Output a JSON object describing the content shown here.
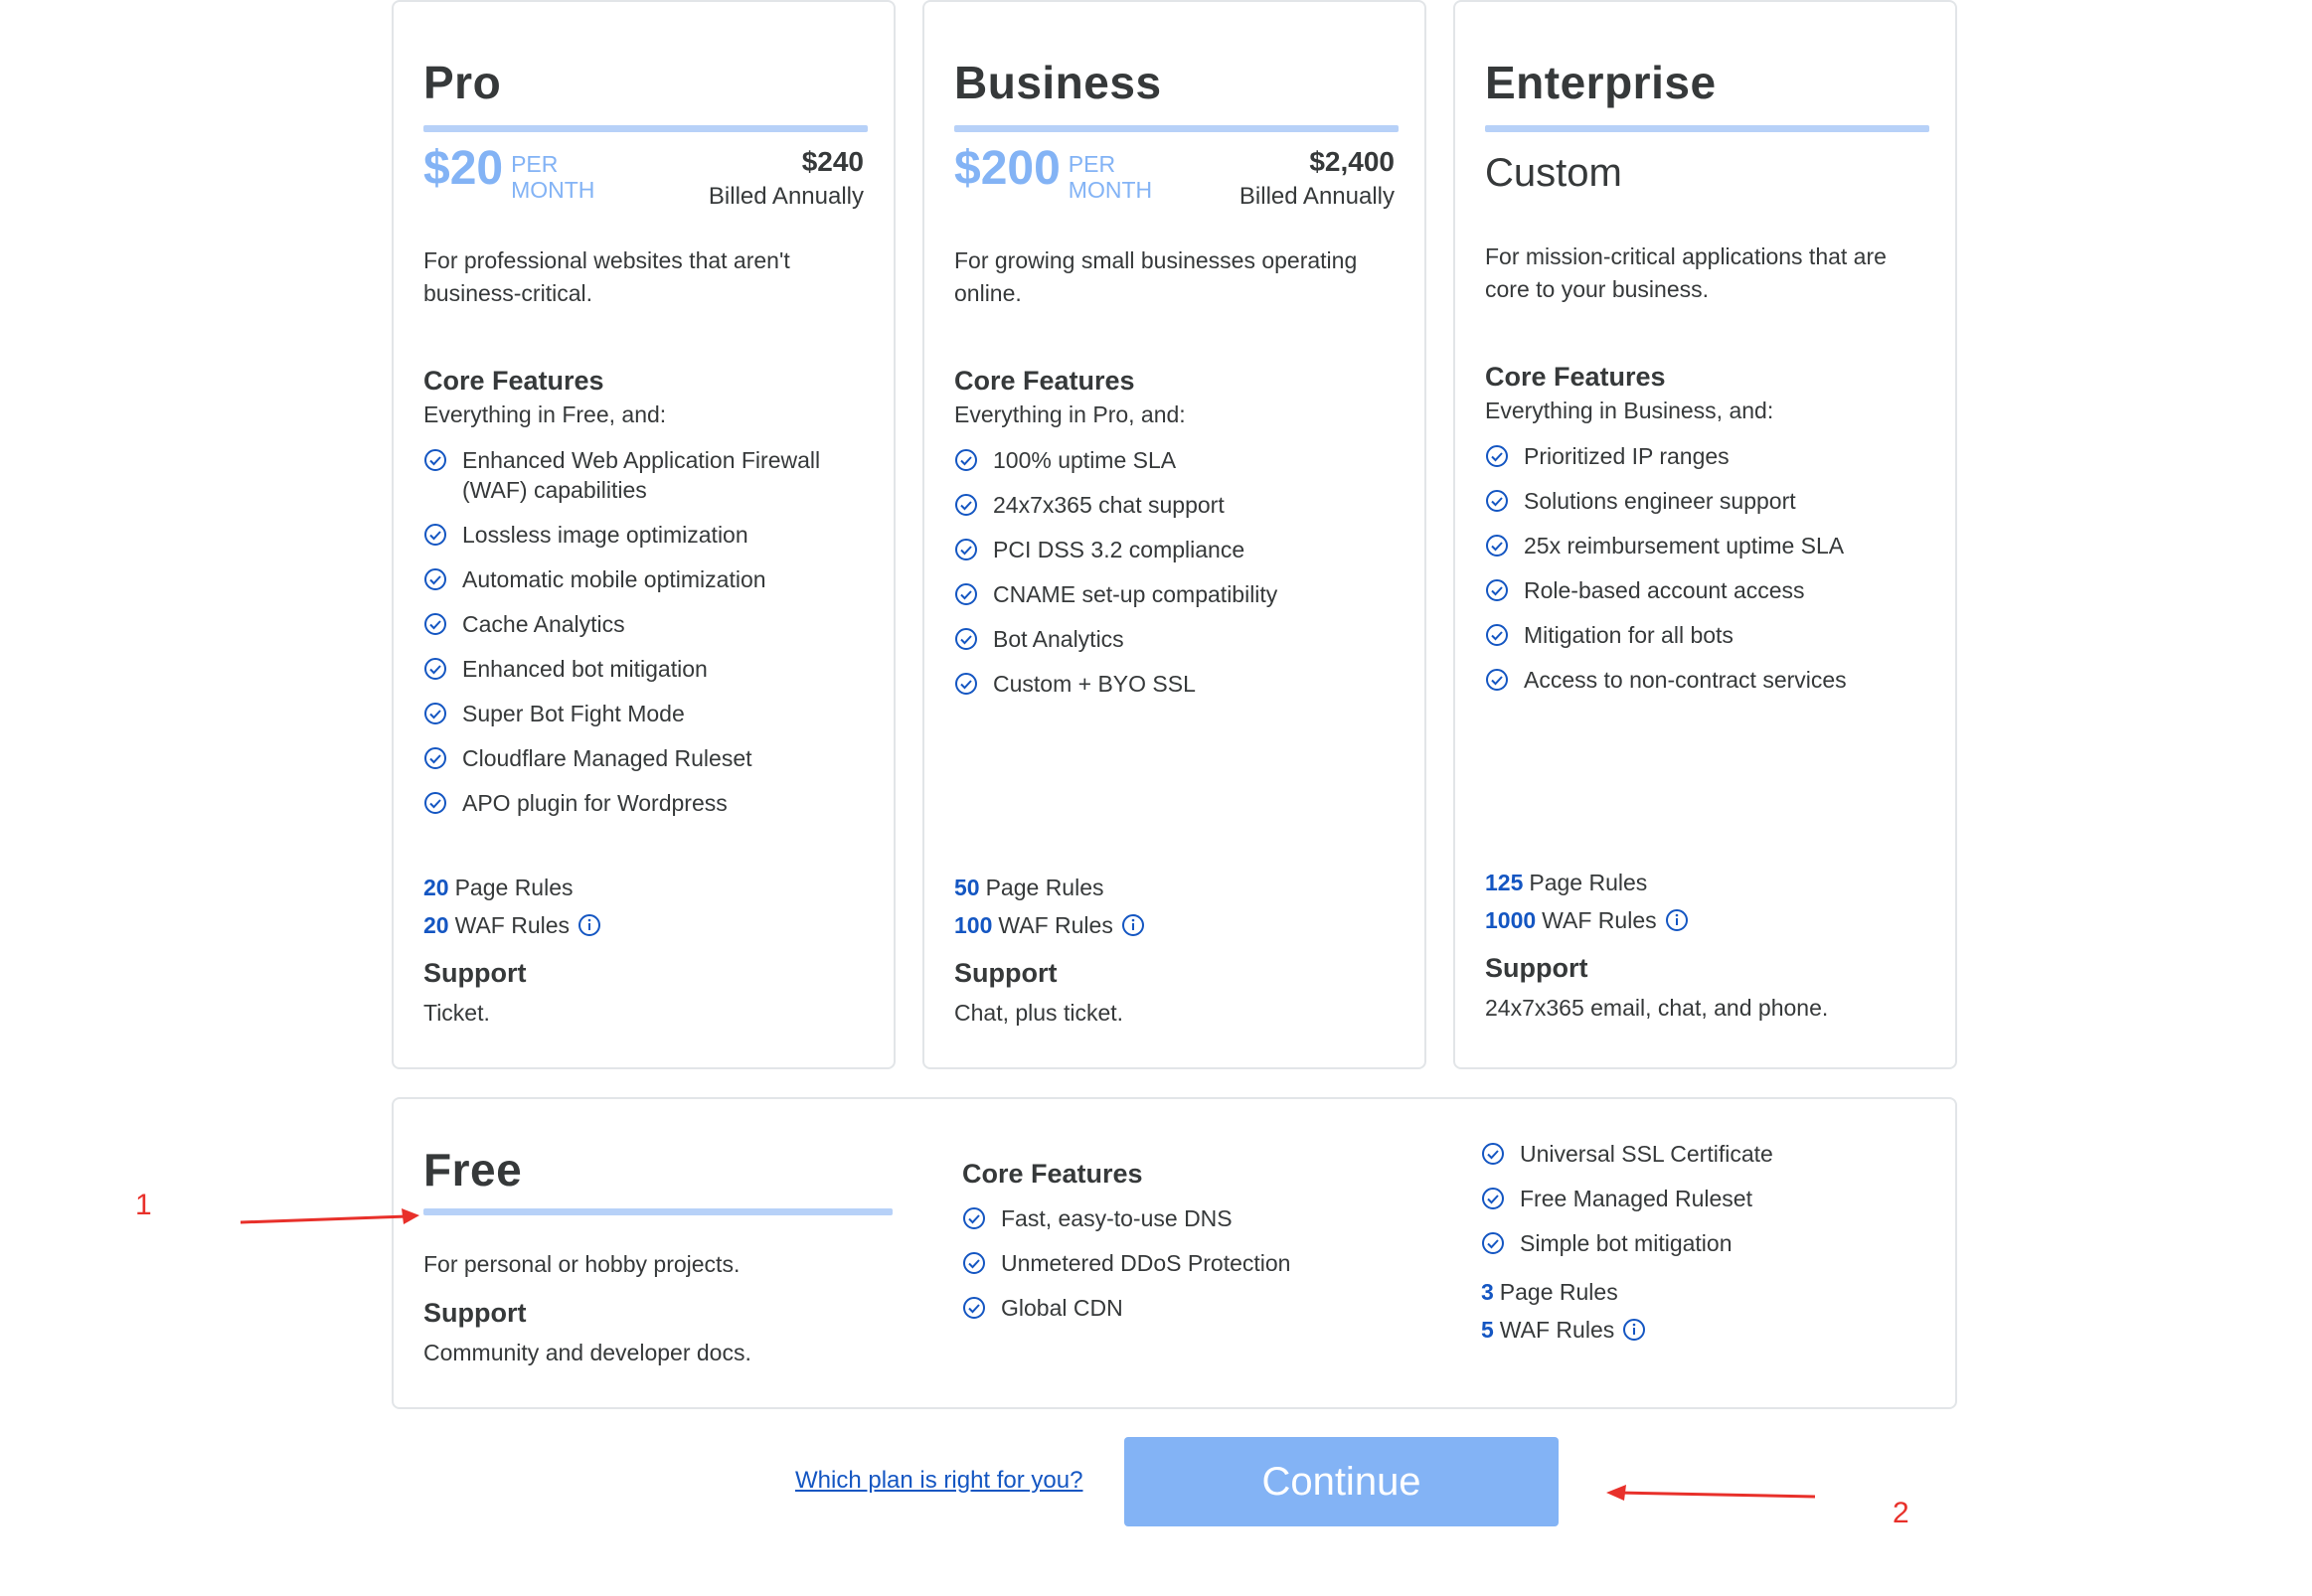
{
  "pro": {
    "name": "Pro",
    "price": "$20",
    "per": "PER",
    "month": "MONTH",
    "annual_total": "$240",
    "annual_label": "Billed Annually",
    "description": "For professional websites that aren't business-critical.",
    "core_title": "Core Features",
    "core_sub": "Everything in Free, and:",
    "features": [
      "Enhanced Web Application Firewall (WAF) capabilities",
      "Lossless image optimization",
      "Automatic mobile optimization",
      "Cache Analytics",
      "Enhanced bot mitigation",
      "Super Bot Fight Mode",
      "Cloudflare Managed Ruleset",
      "APO plugin for Wordpress"
    ],
    "page_rules_num": "20",
    "page_rules_label": "Page Rules",
    "waf_rules_num": "20",
    "waf_rules_label": "WAF Rules",
    "support_title": "Support",
    "support_text": "Ticket."
  },
  "business": {
    "name": "Business",
    "price": "$200",
    "per": "PER",
    "month": "MONTH",
    "annual_total": "$2,400",
    "annual_label": "Billed Annually",
    "description": "For growing small businesses operating online.",
    "core_title": "Core Features",
    "core_sub": "Everything in Pro, and:",
    "features": [
      "100% uptime SLA",
      "24x7x365 chat support",
      "PCI DSS 3.2 compliance",
      "CNAME set-up compatibility",
      "Bot Analytics",
      "Custom + BYO SSL"
    ],
    "page_rules_num": "50",
    "page_rules_label": "Page Rules",
    "waf_rules_num": "100",
    "waf_rules_label": "WAF Rules",
    "support_title": "Support",
    "support_text": "Chat, plus ticket."
  },
  "enterprise": {
    "name": "Enterprise",
    "price_text": "Custom",
    "description": "For mission-critical applications that are core to your business.",
    "core_title": "Core Features",
    "core_sub": "Everything in Business, and:",
    "features": [
      "Prioritized IP ranges",
      "Solutions engineer support",
      "25x reimbursement uptime SLA",
      "Role-based account access",
      "Mitigation for all bots",
      "Access to non-contract services"
    ],
    "page_rules_num": "125",
    "page_rules_label": "Page Rules",
    "waf_rules_num": "1000",
    "waf_rules_label": "WAF Rules",
    "support_title": "Support",
    "support_text": "24x7x365 email, chat, and phone."
  },
  "free": {
    "name": "Free",
    "description": "For personal or hobby projects.",
    "support_title": "Support",
    "support_text": "Community and developer docs.",
    "core_title": "Core Features",
    "features_col1": [
      "Fast, easy-to-use DNS",
      "Unmetered DDoS Protection",
      "Global CDN"
    ],
    "features_col2": [
      "Universal SSL Certificate",
      "Free Managed Ruleset",
      "Simple bot mitigation"
    ],
    "page_rules_num": "3",
    "page_rules_label": "Page Rules",
    "waf_rules_num": "5",
    "waf_rules_label": "WAF Rules"
  },
  "footer": {
    "help_link": "Which plan is right for you?",
    "continue_label": "Continue"
  },
  "annotations": {
    "marker_1": "1",
    "marker_2": "2"
  },
  "colors": {
    "accent_light": "#83b3f5",
    "rule_blue": "#b7d1f8",
    "link_blue": "#1456c2",
    "annotation_red": "#e8302a"
  },
  "icons": {
    "feature": "check-circle-icon",
    "info": "info-circle-icon"
  }
}
